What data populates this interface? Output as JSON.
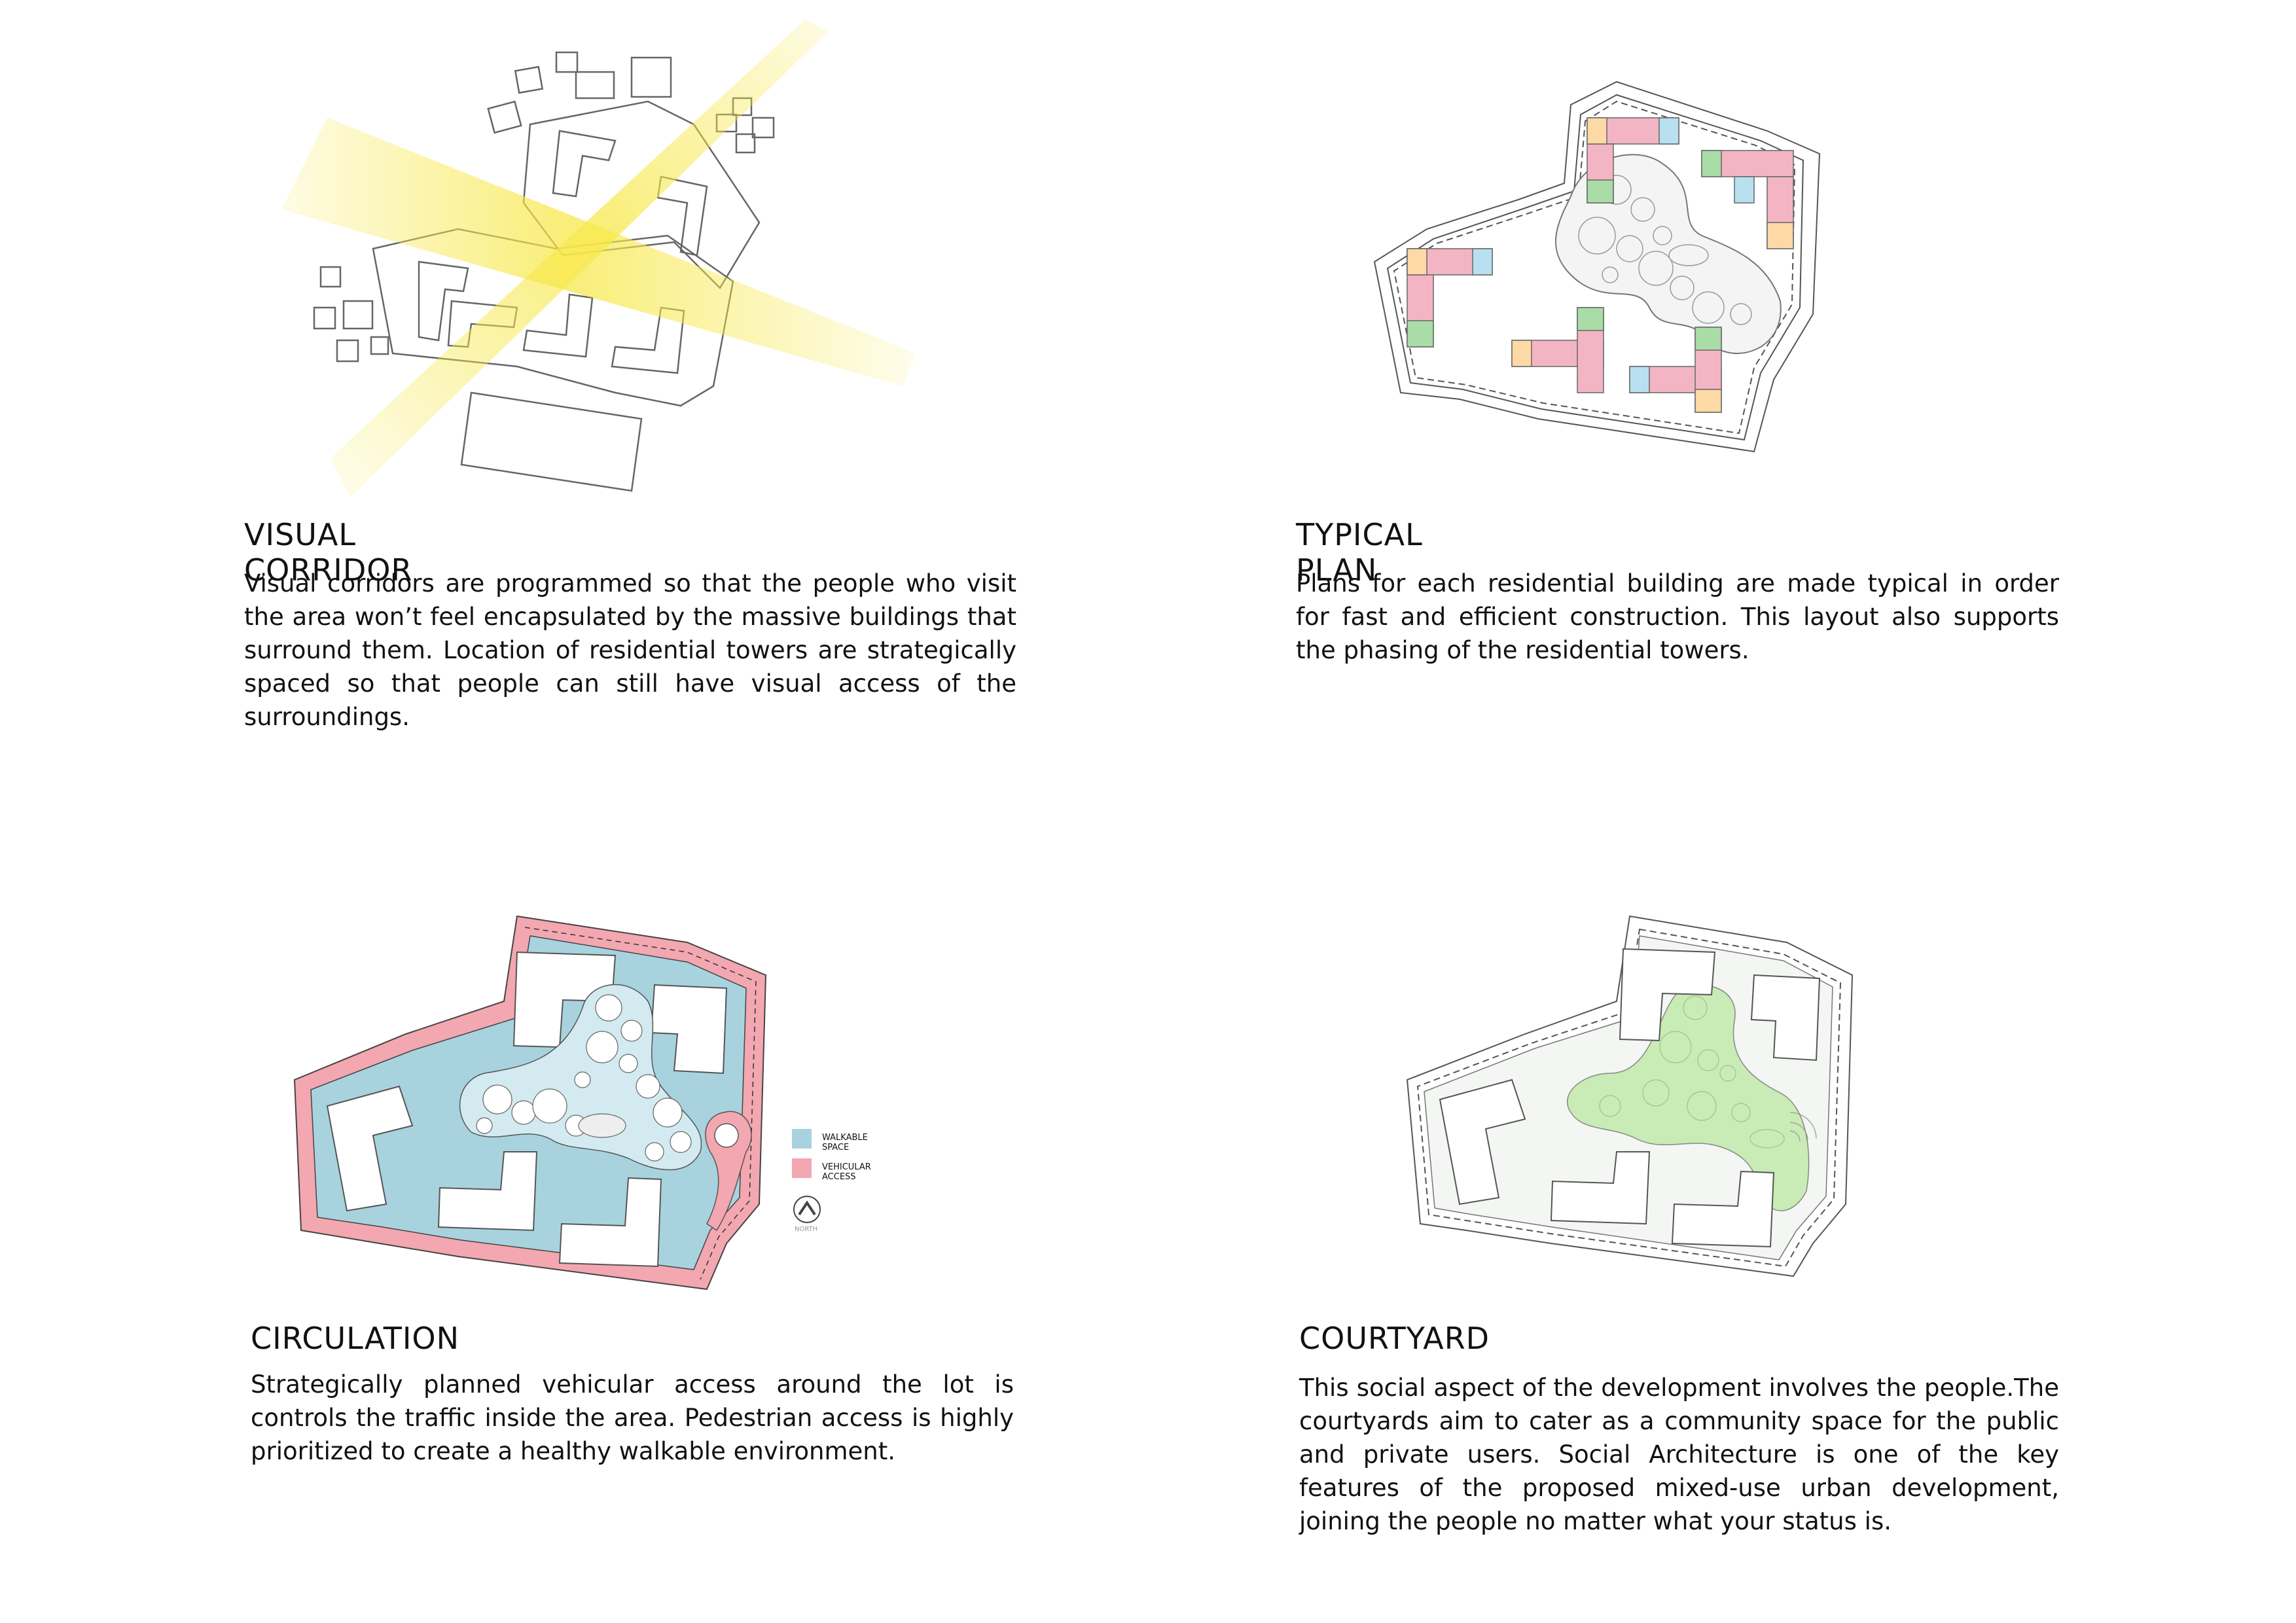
{
  "panels": {
    "visual_corridor": {
      "title": "VISUAL CORRIDOR",
      "body": "Visual corridors are programmed so that the people who visit the area won’t feel encapsulated by the massive buildings that surround them. Location of residential towers are strategically spaced so that people can still have visual access of the surroundings."
    },
    "typical_plan": {
      "title": "TYPICAL PLAN",
      "body": "Plans for each residential building are made typical in order for fast and efficient construction. This layout also supports the phasing of the residential towers."
    },
    "circulation": {
      "title": "CIRCULATION",
      "body": "Strategically planned vehicular access around the lot is controls the traffic inside the area. Pedestrian access is highly prioritized to create a healthy walkable environment.",
      "legend": [
        {
          "label": "WALKABLE SPACE",
          "color": "#a8d3de"
        },
        {
          "label": "VEHICULAR ACCESS",
          "color": "#f3a7b0"
        }
      ],
      "north_label": "NORTH"
    },
    "courtyard": {
      "title": "COURTYARD",
      "body": "This social aspect of the development involves the people.The courtyards aim to cater as a community space for the public and private users. Social Architecture is one of the key features of the proposed mixed-use urban development, joining the people no matter what your status is."
    }
  },
  "colors": {
    "corridor_yellow": "#f7e84a",
    "walkable": "#a8d3de",
    "vehicular": "#f3a7b0",
    "courtyard_green": "#c9ebb5",
    "line": "#555555"
  }
}
